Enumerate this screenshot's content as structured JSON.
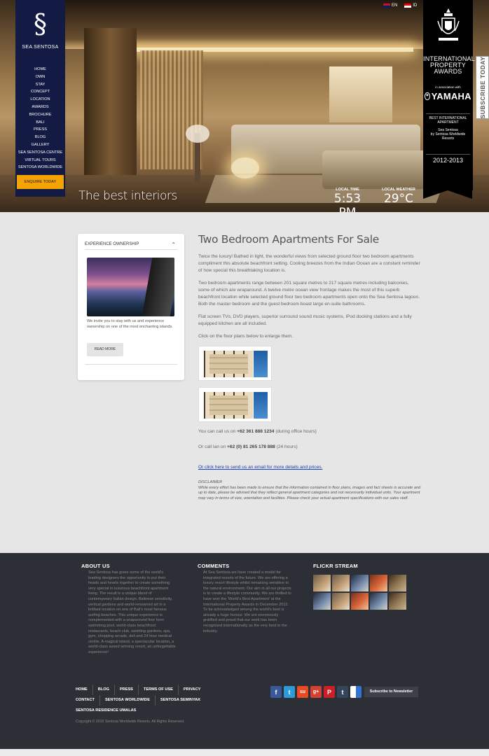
{
  "hero": {
    "tagline": "The best interiors",
    "local_time_label": "LOCAL TIME",
    "local_time": "5:53 PM",
    "local_weather_label": "LOCAL WEATHER",
    "local_weather": "29°C",
    "languages": [
      {
        "code": "EN",
        "icon": "uk-flag-icon"
      },
      {
        "code": "ID",
        "icon": "indonesia-flag-icon"
      }
    ]
  },
  "brand": {
    "logo_mark": "§",
    "name": "SEA SENTOSA"
  },
  "nav": {
    "items": [
      "HOME",
      "OWN",
      "STAY",
      "CONCEPT",
      "LOCATION",
      "AWARDS",
      "BROCHURE",
      "BALI",
      "PRESS",
      "BLOG",
      "GALLERY",
      "SEA SENTOSA CENTRE",
      "VIRTUAL TOURS",
      "SENTOSA WORLDWIDE"
    ],
    "cta": "ENQUIRE TODAY"
  },
  "award": {
    "title_lines": [
      "INTERNATIONAL",
      "PROPERTY",
      "AWARDS"
    ],
    "assoc": "in association with",
    "sponsor": "YAMAHA",
    "category_lines": [
      "BEST INTERNATIONAL",
      "APARTMENT"
    ],
    "entry_lines": [
      "Sea Sentosa",
      "by Sentosa Worldwide",
      "Resorts"
    ],
    "year": "2012-2013"
  },
  "subscribe": {
    "label": "SUBSCRIBE TODAY"
  },
  "sidebox": {
    "heading": "EXPERIENCE OWNERSHIP",
    "text": "We invite you to stay with us and experience ownership on one of the most enchanting islands.",
    "button": "READ MORE"
  },
  "content": {
    "title": "Two Bedroom Apartments For Sale",
    "paragraphs": [
      "Twice the luxury! Bathed in light, the wonderful views from selected ground floor two bedroom apartments compliment this absolute beachfront setting. Cooling breezes from the Indian Ocean are a constant reminder of how special this breathtaking location is.",
      "Two bedroom apartments range between 201 square metres to 217 square metres including balconies, some of which are wraparound. A twelve metre ocean view frontage makes the most of this superb beachfront location while selected ground floor two bedroom apartments open onto the Sea Sentosa lagoon. Both the master bedroom and the guest bedroom boast large en-suite bathrooms.",
      "Flat screen TVs, DVD players, superior surround sound music systems, iPod docking stations and a fully equipped kitchen are all included.",
      "Click on the floor plans below to enlarge them."
    ],
    "call1_prefix": "You can call us on ",
    "call1_number": "+62 361 888 1234",
    "call1_suffix": " (during office hours)",
    "call2_prefix": "Or call Ian on ",
    "call2_number": "+62 (0) 81 265 178 888",
    "call2_suffix": " (24 hours)",
    "email_link": "Or click here to send us an email for more details and prices.",
    "disclaimer_title": "DISCLAIMER",
    "disclaimer": "While every effort has been made to ensure that the information contained in floor plans, images and fact sheets is accurate and up to date, please be advised that they reflect general apartment categories and not necessarily individual units. Your apartment may vary in terms of size, orientation and facilities. Please check your actual apartment specifications with our sales staff."
  },
  "footer": {
    "about_title": "ABOUT US",
    "about_text": "Sea Sentosa has given some of the world's leading designers the opportunity to put their heads and hearts together to create something very special in luxurious beachfront apartment living. The result is a unique blend of contemporary Italian design, Balinese sensitivity, vertical gardens and world-renowned art in a brilliant location on one of Bali's most famous surfing beaches. This unique experience is complemented with a wraparound free form swimming pool, world-class beachfront restaurants, beach club, wedding gardens, spa, gym, shopping arcade, deli and 24 hour medical centre. A magical island, a spectacular location, a world-class award winning resort, an unforgettable experience!",
    "comments_title": "COMMENTS",
    "comments_text": "At Sea Sentosa we have created a model for integrated resorts of the future. We are offering a luxury resort lifestyle whilst remaining sensitive to the natural environment. Our aim in all our projects is to create a lifestyle community. We are thrilled to have won the 'World's Best Apartment' at the International Property Awards in December 2012. To be acknowledged among the world's best is already a huge honour. We are enormously gratified and proud that our work has been recognised internationally as the very best in the industry.",
    "flickr_title": "FLICKR STREAM",
    "links": [
      "HOME",
      "BLOG",
      "PRESS",
      "TERMS OF USE",
      "PRIVACY",
      "CONTACT",
      "SENTOSA WORLDWIDE",
      "SENTOSA SEMINYAK",
      "SENTOSA RESIDENCE UMALAS"
    ],
    "copyright": "Copyright © 2015 Sentosa Worldwide Resorts. All Rights Reserved.",
    "social": [
      {
        "icon": "facebook-icon",
        "glyph": "f",
        "color": "#3b5998"
      },
      {
        "icon": "twitter-icon",
        "glyph": "t",
        "color": "#2d9bd8"
      },
      {
        "icon": "stumbleupon-icon",
        "glyph": "su",
        "color": "#eb4924"
      },
      {
        "icon": "google-plus-icon",
        "glyph": "g+",
        "color": "#d44132"
      },
      {
        "icon": "pinterest-icon",
        "glyph": "P",
        "color": "#cb2027"
      },
      {
        "icon": "tumblr-icon",
        "glyph": "t",
        "color": "#35465c"
      },
      {
        "icon": "delicious-icon",
        "glyph": "",
        "color": "#3274d1"
      }
    ],
    "newsletter": "Subscribe to Newsletter"
  }
}
